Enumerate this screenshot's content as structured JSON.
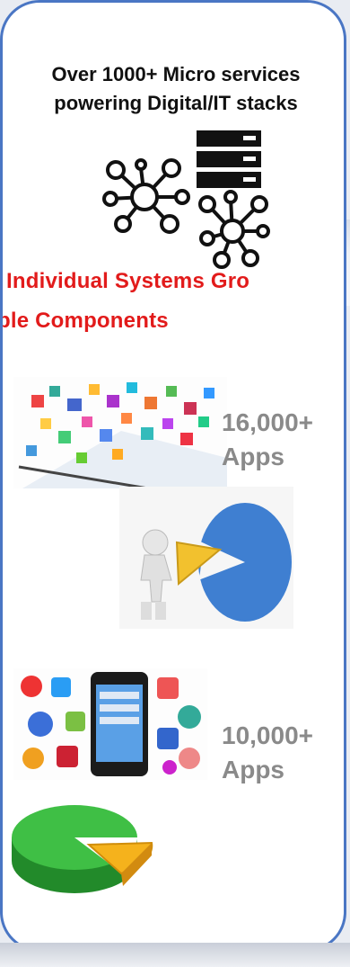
{
  "headline": {
    "line1": "Over 1000+ Micro services",
    "line2": "powering Digital/IT stacks"
  },
  "banner": {
    "line1": "Individual Systems Gro",
    "line2": "ble Components"
  },
  "stats": [
    {
      "value": "16,000+",
      "unit": "Apps"
    },
    {
      "value": "10,000+",
      "unit": "Apps"
    }
  ],
  "icons": [
    "network-graph-icon",
    "server-stack-icon",
    "network-graph-icon"
  ],
  "colors": {
    "frame_border": "#4a76c4",
    "banner_text": "#e21b1b",
    "stat_text": "#8a8a8a",
    "pie_blue": "#3f7fd1",
    "pie_green": "#36b33a",
    "wedge_yellow": "#f2c12e"
  }
}
